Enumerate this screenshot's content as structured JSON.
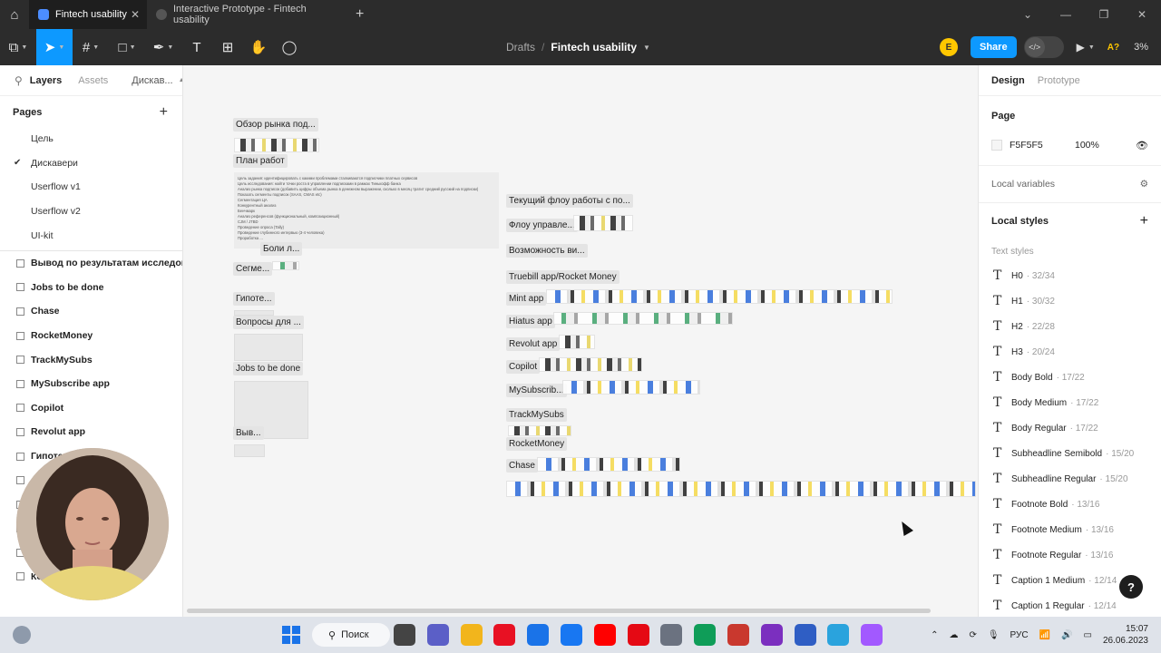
{
  "browser": {
    "tabs": [
      {
        "label": "Fintech usability",
        "active": true
      },
      {
        "label": "Interactive Prototype - Fintech usability",
        "active": false
      }
    ]
  },
  "toolbar": {
    "breadcrumb_root": "Drafts",
    "breadcrumb_separator": "/",
    "file_name": "Fintech usability",
    "avatar_letter": "E",
    "share_label": "Share",
    "font_indicator": "A?",
    "zoom": "3%"
  },
  "left_panel": {
    "tab_layers": "Layers",
    "tab_assets": "Assets",
    "current_page_short": "Дискав...",
    "pages_title": "Pages",
    "pages": [
      {
        "label": "Цель",
        "selected": false
      },
      {
        "label": "Дискавери",
        "selected": true
      },
      {
        "label": "Userflow v1",
        "selected": false
      },
      {
        "label": "Userflow v2",
        "selected": false
      },
      {
        "label": "UI-kit",
        "selected": false
      }
    ],
    "layers": [
      "Вывод по результатам исследов...",
      "Jobs to be done",
      "Chase",
      "RocketMoney",
      "TrackMySubs",
      "MySubscribe app",
      "Copilot",
      "Revolut app",
      "Гипотезы",
      "",
      "",
      "",
      "",
      "Конкуренты"
    ]
  },
  "canvas": {
    "left_column_labels": [
      "Обзор рынка под...",
      "План работ",
      "Боли л...",
      "Сегме...",
      "Гипоте...",
      "Вопросы для ...",
      "Jobs to be done",
      "Выв..."
    ],
    "doc_lines": [
      "Цель задания: идентифицировать с какими проблемами сталкиваются подписчики платных сервисов",
      "Цель исследования: найти точки роста в управлении подписками в рамках Тинькофф банка",
      "Анализ рынка подписок (добавить цифры объема рынка в денежном выражении, сколько в месяц тратит средний русский на подписки)",
      "Показать сегменты подписок (SAAS, CMAS etc)",
      "Сегментация ЦА",
      "Конкурентный анализ",
      "Бенчмарк",
      "Анализ референсов (функциональный, композиционный)",
      "CJM / JTBD",
      "Проведение опроса (Tally)",
      "Проведение глубинного интервью (3-4 человека)",
      "Проработка ..."
    ],
    "right_column_labels": [
      "Текущий флоу работы с по...",
      "Флоу управле...",
      "Возможность ви...",
      "Truebill app/Rocket Money",
      "Mint app",
      "Hiatus app",
      "Revolut app",
      "Copilot",
      "MySubscrib...",
      "TrackMySubs",
      "RocketMoney",
      "Chase"
    ]
  },
  "right_panel": {
    "tab_design": "Design",
    "tab_prototype": "Prototype",
    "page_section": "Page",
    "page_color": "F5F5F5",
    "page_opacity": "100%",
    "local_variables": "Local variables",
    "local_styles": "Local styles",
    "text_styles_title": "Text styles",
    "text_styles": [
      {
        "name": "H0",
        "meta": "32/34"
      },
      {
        "name": "H1",
        "meta": "30/32"
      },
      {
        "name": "H2",
        "meta": "22/28"
      },
      {
        "name": "H3",
        "meta": "20/24"
      },
      {
        "name": "Body Bold",
        "meta": "17/22"
      },
      {
        "name": "Body Medium",
        "meta": "17/22"
      },
      {
        "name": "Body Regular",
        "meta": "17/22"
      },
      {
        "name": "Subheadline Semibold",
        "meta": "15/20"
      },
      {
        "name": "Subheadline Regular",
        "meta": "15/20"
      },
      {
        "name": "Footnote Bold",
        "meta": "13/16"
      },
      {
        "name": "Footnote Medium",
        "meta": "13/16"
      },
      {
        "name": "Footnote Regular",
        "meta": "13/16"
      },
      {
        "name": "Caption 1 Medium",
        "meta": "12/14"
      },
      {
        "name": "Caption 1 Regular",
        "meta": "12/14"
      }
    ],
    "help": "?"
  },
  "taskbar": {
    "search_label": "Поиск",
    "language": "РУС",
    "time": "15:07",
    "date": "26.06.2023",
    "app_colors": [
      "#444444",
      "#5b5fc7",
      "#f2b51c",
      "#e81123",
      "#1a73e8",
      "#1877f2",
      "#ff0000",
      "#e50914",
      "#6b7280",
      "#0f9d58",
      "#c9382e",
      "#7b2fbf",
      "#2f5ec4",
      "#2aa3dd",
      "#a259ff"
    ]
  }
}
